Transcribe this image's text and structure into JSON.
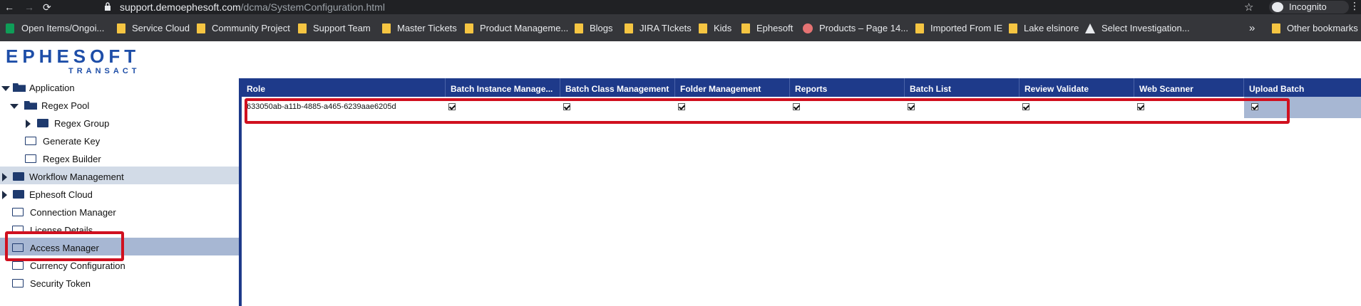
{
  "browser": {
    "url_host": "support.demoephesoft.com",
    "url_path": "/dcma/SystemConfiguration.html",
    "profile_label": "Incognito",
    "nav_back": "←",
    "nav_forward": "→",
    "nav_reload": "⟳",
    "star": "☆",
    "menu": "⋮",
    "bookmarks_overflow": "»"
  },
  "bookmarks": [
    {
      "label": "Open Items/Ongoi...",
      "icon": "sheets-icon"
    },
    {
      "label": "Service Cloud",
      "icon": "folder-icon"
    },
    {
      "label": "Community Project",
      "icon": "folder-icon"
    },
    {
      "label": "Support Team",
      "icon": "folder-icon"
    },
    {
      "label": "Master Tickets",
      "icon": "folder-icon"
    },
    {
      "label": "Product Manageme...",
      "icon": "folder-icon"
    },
    {
      "label": "Blogs",
      "icon": "folder-icon"
    },
    {
      "label": "JIRA TIckets",
      "icon": "folder-icon"
    },
    {
      "label": "Kids",
      "icon": "folder-icon"
    },
    {
      "label": "Ephesoft",
      "icon": "folder-icon"
    },
    {
      "label": "Products – Page 14...",
      "icon": "site-icon"
    },
    {
      "label": "Imported From IE",
      "icon": "folder-icon"
    },
    {
      "label": "Lake elsinore",
      "icon": "folder-icon"
    },
    {
      "label": "Select Investigation...",
      "icon": "site-icon"
    },
    {
      "label": "Other bookmarks",
      "icon": "folder-icon"
    }
  ],
  "logo": {
    "main": "EPHESOFT",
    "sub": "TRANSACT"
  },
  "tree": {
    "application": "Application",
    "regex_pool": "Regex Pool",
    "regex_group": "Regex Group",
    "generate_key": "Generate Key",
    "regex_builder": "Regex Builder",
    "workflow_management": "Workflow Management",
    "ephesoft_cloud": "Ephesoft Cloud",
    "connection_manager": "Connection Manager",
    "license_details": "License Details",
    "access_manager": "Access Manager",
    "currency_configuration": "Currency Configuration",
    "security_token": "Security Token"
  },
  "grid": {
    "headers": [
      "Role",
      "Batch Instance Manage...",
      "Batch Class Management",
      "Folder Management",
      "Reports",
      "Batch List",
      "Review Validate",
      "Web Scanner",
      "Upload Batch"
    ],
    "rows": [
      {
        "role": "633050ab-a11b-4885-a465-6239aae6205d",
        "checked": [
          true,
          true,
          true,
          true,
          true,
          true,
          true,
          true
        ]
      }
    ]
  },
  "colors": {
    "header_bg": "#1e3a8a",
    "highlight_red": "#d0101f",
    "selected_row": "#a7b7d3"
  }
}
